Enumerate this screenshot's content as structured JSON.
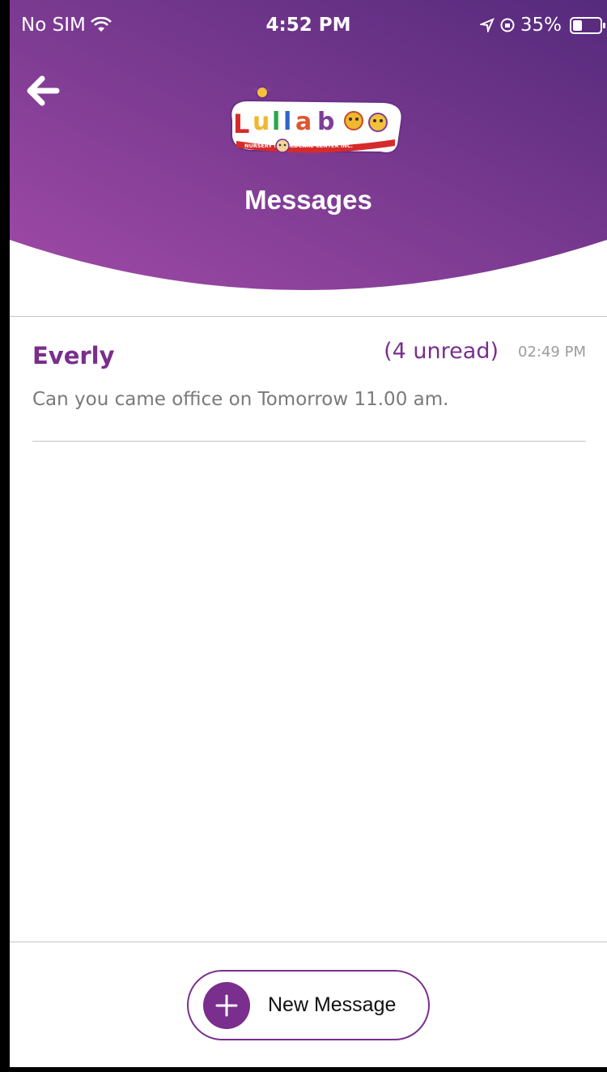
{
  "status_bar": {
    "carrier": "No SIM",
    "time": "4:52 PM",
    "battery": "35%",
    "battery_level": 0.35,
    "icons": [
      "wifi-icon",
      "location-arrow-icon",
      "orientation-lock-icon",
      "battery-icon"
    ]
  },
  "header": {
    "title": "Messages",
    "logo_text": "Lullaboo",
    "logo_subtitle": "NURSERY & CHILDCARE CENTER INC.",
    "back_icon": "back-arrow-icon",
    "gradient_colors": [
      "#9b4aa8",
      "#5a2a7e"
    ]
  },
  "messages": [
    {
      "sender": "Everly",
      "unread": "(4 unread)",
      "time": "02:49 PM",
      "preview": "Can you came office on Tomorrow 11.00 am."
    }
  ],
  "new_message_button": {
    "label": "New Message",
    "icon": "plus-icon"
  },
  "colors": {
    "accent": "#7a2e8d",
    "secondary_text": "#7a7a7a",
    "timestamp_text": "#9c9c9c"
  }
}
